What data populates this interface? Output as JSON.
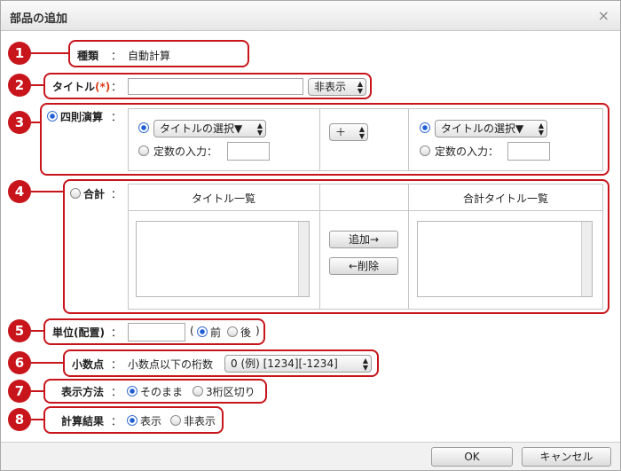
{
  "dialog": {
    "title": "部品の追加",
    "close": "×",
    "ok_label": "OK",
    "cancel_label": "キャンセル"
  },
  "colon": "：",
  "badges": [
    "1",
    "2",
    "3",
    "4",
    "5",
    "6",
    "7",
    "8"
  ],
  "row1": {
    "label": "種類",
    "value": "自動計算"
  },
  "row2": {
    "label": "タイトル",
    "required": "(*)",
    "input_value": "",
    "visibility_select": "非表示"
  },
  "row3": {
    "label": "四則演算",
    "left_title_select": "タイトルの選択▼",
    "left_constant_label": "定数の入力：",
    "operator_select": "＋",
    "right_title_select": "タイトルの選択▼",
    "right_constant_label": "定数の入力："
  },
  "row4": {
    "label": "合計",
    "left_header": "タイトル一覧",
    "right_header": "合計タイトル一覧",
    "add_button": "追加→",
    "delete_button": "←削除"
  },
  "row5": {
    "label": "単位(配置)",
    "paren_open": "(",
    "before_label": "前",
    "after_label": "後",
    "paren_close": ")"
  },
  "row6": {
    "label": "小数点",
    "sub_label": "小数点以下の桁数",
    "select_value": "0 (例) [1234][-1234]"
  },
  "row7": {
    "label": "表示方法",
    "option1": "そのまま",
    "option2": "3桁区切り"
  },
  "row8": {
    "label": "計算結果",
    "option1": "表示",
    "option2": "非表示"
  },
  "colors": {
    "annotation_red": "#c8151b",
    "radio_selected": "#1f5fd6"
  }
}
